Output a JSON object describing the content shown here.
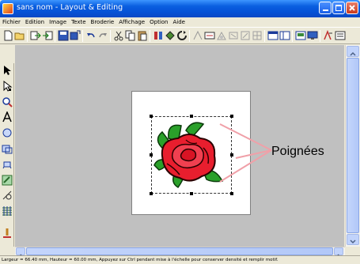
{
  "window": {
    "title": "sans nom - Layout & Editing"
  },
  "menu": {
    "items": [
      "Fichier",
      "Edition",
      "Image",
      "Texte",
      "Broderie",
      "Affichage",
      "Option",
      "Aide"
    ]
  },
  "toolbar": {
    "icons": [
      "new-file-icon",
      "open-file-icon",
      "import-icon",
      "export-icon",
      "save-icon",
      "save-as-icon",
      "undo-icon",
      "redo-icon",
      "cut-icon",
      "copy-icon",
      "paste-icon",
      "transform-icon",
      "rotate-icon",
      "refresh-icon",
      "pattern-icon",
      "stitch-icon",
      "view-icon",
      "preview-icon",
      "design-center-icon",
      "grid-icon",
      "zoom-icon",
      "help-icon"
    ]
  },
  "left_tools": [
    "select-arrow-icon",
    "point-edit-icon",
    "zoom-icon",
    "text-icon",
    "circle-icon",
    "rectangle-icon",
    "pen-icon",
    "brush-icon",
    "ruler-icon",
    "stitch-pattern-icon",
    "color-icon"
  ],
  "callout": {
    "label": "Poignées"
  },
  "status": {
    "text": "Largeur = 66.40 mm, Hauteur = 60.00 mm, Appuyez sur Ctrl pendant mise à l'échelle pour conserver densité et remplir motif."
  }
}
